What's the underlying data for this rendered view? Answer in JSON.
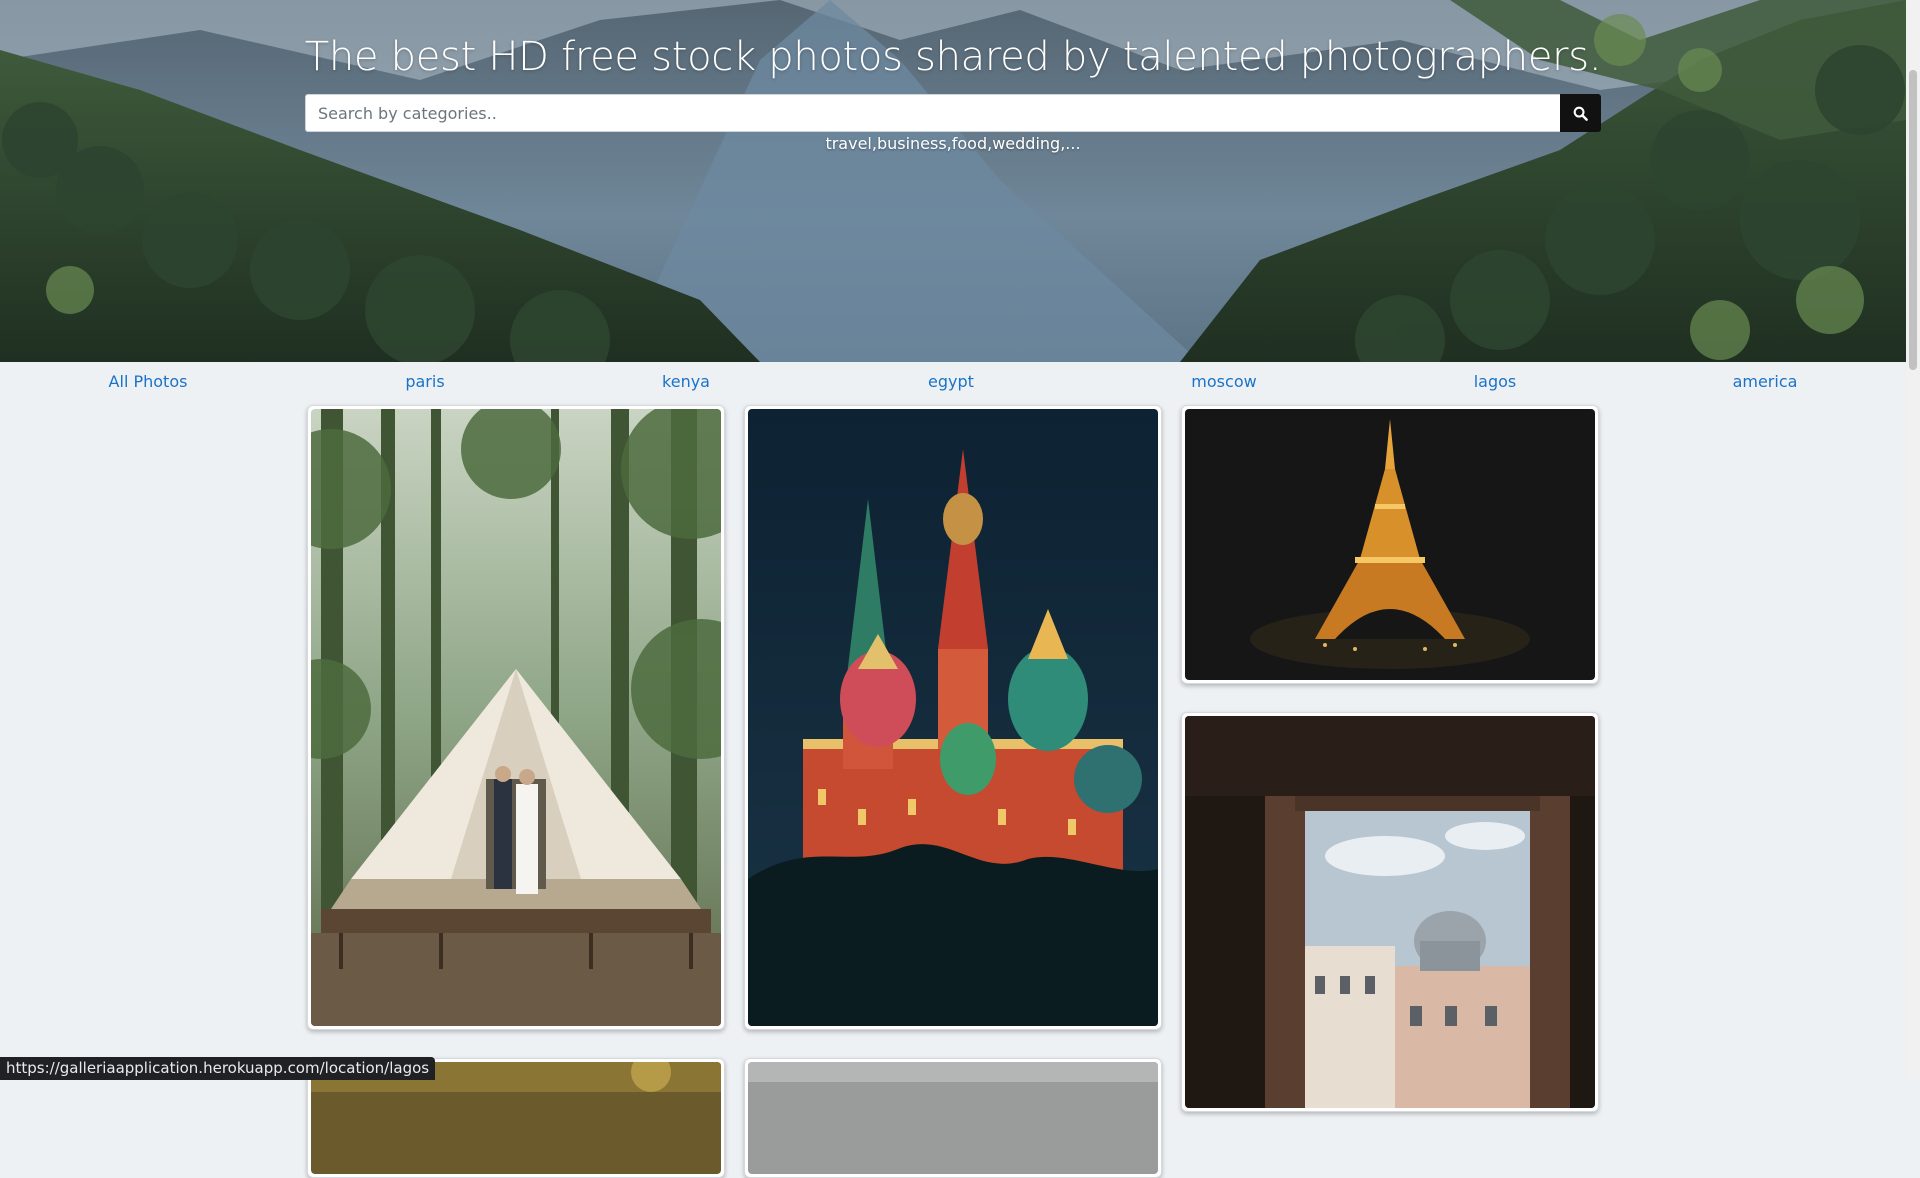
{
  "hero": {
    "title": "The best HD free stock photos shared by talented photographers.",
    "search": {
      "placeholder": "Search by categories..",
      "value": "",
      "button_icon": "search-icon"
    },
    "hint": "travel,business,food,wedding,..."
  },
  "categories": [
    {
      "label": "All Photos"
    },
    {
      "label": "paris"
    },
    {
      "label": "kenya"
    },
    {
      "label": "egypt"
    },
    {
      "label": "moscow"
    },
    {
      "label": "lagos"
    },
    {
      "label": "america"
    }
  ],
  "gallery": {
    "photos": [
      {
        "subject": "wedding-tent-photo"
      },
      {
        "subject": "moscow-cathedral-photo"
      },
      {
        "subject": "eiffel-tower-photo"
      },
      {
        "subject": "paris-window-photo"
      },
      {
        "subject": "autumn-photo"
      },
      {
        "subject": "cloudy-photo"
      }
    ]
  },
  "status_bar": {
    "url": "https://galleriaapplication.herokuapp.com/location/lagos"
  },
  "colors": {
    "link": "#1a73c8",
    "page_background": "#eef1f4",
    "search_button": "#111111"
  }
}
